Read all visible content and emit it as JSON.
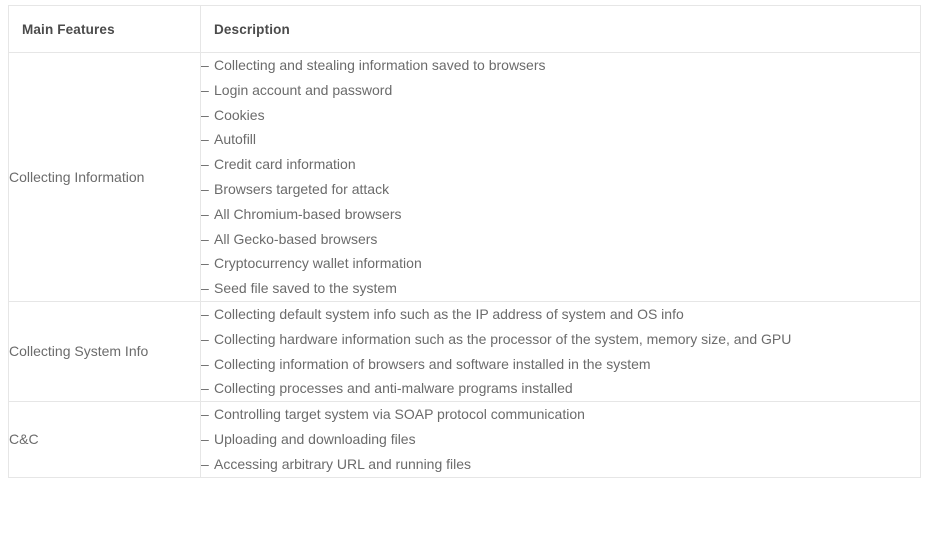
{
  "table": {
    "headers": [
      {
        "label": "Main Features"
      },
      {
        "label": "Description"
      }
    ],
    "bullet_marker": "–",
    "rows": [
      {
        "feature": "Collecting Information",
        "items": [
          "Collecting and stealing information saved to browsers",
          "Login account and password",
          "Cookies",
          "Autofill",
          "Credit card information",
          "Browsers targeted for attack",
          "All Chromium-based browsers",
          "All Gecko-based browsers",
          "Cryptocurrency wallet information",
          "Seed file saved to the system"
        ]
      },
      {
        "feature": "Collecting System Info",
        "items": [
          "Collecting default system info such as the IP address of system and OS info",
          "Collecting hardware information such as the processor of the system, memory size, and GPU",
          "Collecting information of browsers and software installed in the system",
          "Collecting processes and anti-malware programs installed"
        ]
      },
      {
        "feature": "C&C",
        "items": [
          "Controlling target system via SOAP protocol communication",
          "Uploading and downloading files",
          "Accessing arbitrary URL and running files"
        ]
      }
    ]
  },
  "colors": {
    "border": "#e6e6e6",
    "header_text": "#4b4b4b",
    "body_text": "#6b6b6b",
    "background": "#ffffff"
  }
}
